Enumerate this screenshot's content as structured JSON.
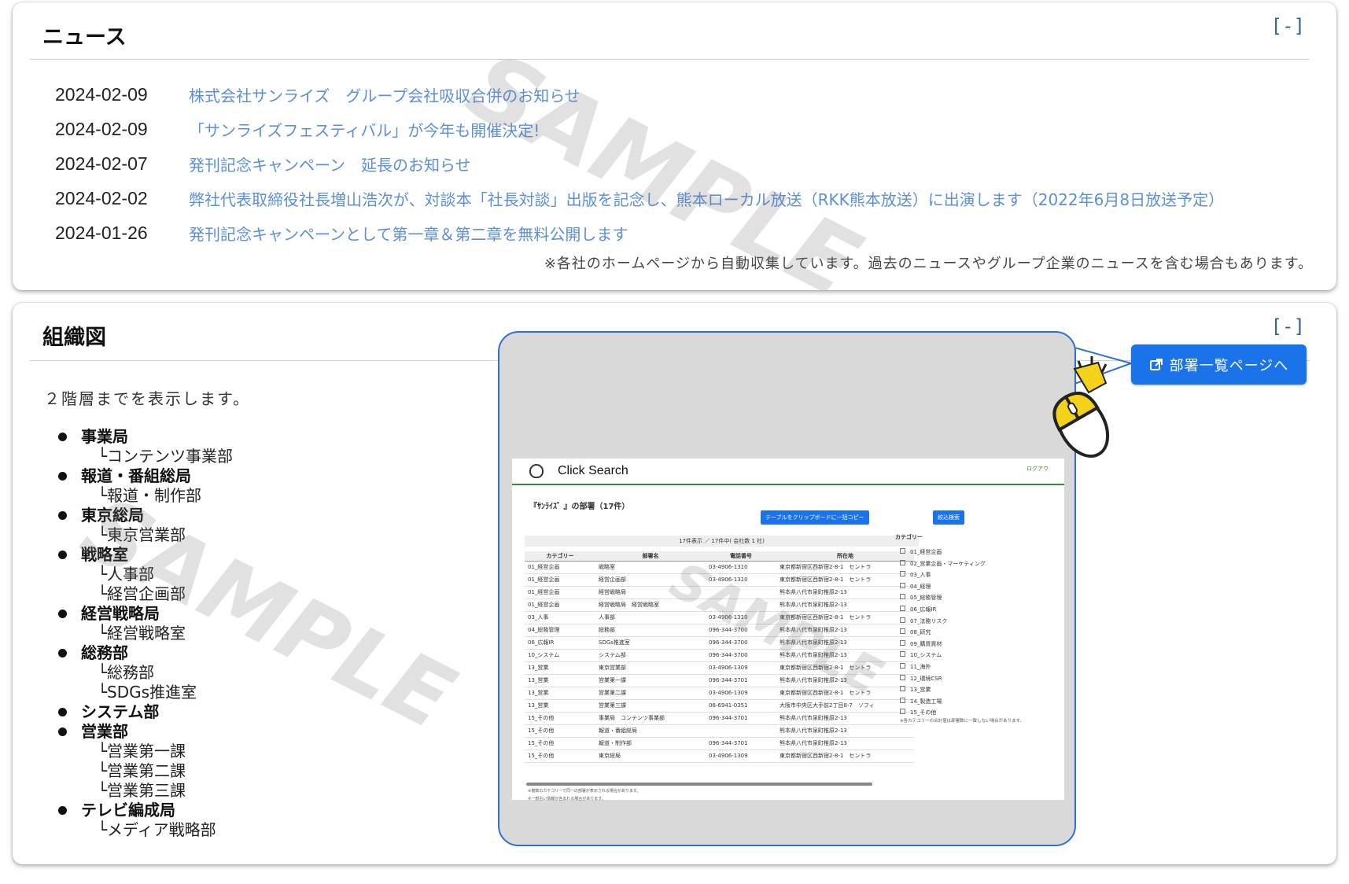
{
  "watermark": "SAMPLE",
  "news": {
    "title": "ニュース",
    "collapse_label": "[-]",
    "items": [
      {
        "date": "2024-02-09",
        "title": "株式会社サンライズ　グループ会社吸収合併のお知らせ"
      },
      {
        "date": "2024-02-09",
        "title": "「サンライズフェスティバル」が今年も開催決定!"
      },
      {
        "date": "2024-02-07",
        "title": "発刊記念キャンペーン　延長のお知らせ"
      },
      {
        "date": "2024-02-02",
        "title": "弊社代表取締役社長増山浩次が、対談本「社長対談」出版を記念し、熊本ローカル放送（RKK熊本放送）に出演します（2022年6月8日放送予定）"
      },
      {
        "date": "2024-01-26",
        "title": "発刊記念キャンペーンとして第一章＆第二章を無料公開します"
      }
    ],
    "note": "※各社のホームページから自動収集しています。過去のニュースやグループ企業のニュースを含む場合もあります。"
  },
  "org": {
    "title": "組織図",
    "collapse_label": "[-]",
    "description": "２階層までを表示します。",
    "departments": [
      {
        "name": "事業局",
        "subs": [
          "└コンテンツ事業部"
        ]
      },
      {
        "name": "報道・番組総局",
        "subs": [
          "└報道・制作部"
        ]
      },
      {
        "name": "東京総局",
        "subs": [
          "└東京営業部"
        ]
      },
      {
        "name": "戦略室",
        "subs": [
          "└人事部",
          "└経営企画部"
        ]
      },
      {
        "name": "経営戦略局",
        "subs": [
          "└経営戦略室"
        ]
      },
      {
        "name": "総務部",
        "subs": [
          "└総務部",
          "└SDGs推進室"
        ]
      },
      {
        "name": "システム部",
        "subs": []
      },
      {
        "name": "営業部",
        "subs": [
          "└営業第一課",
          "└営業第二課",
          "└営業第三課"
        ]
      },
      {
        "name": "テレビ編成局",
        "subs": [
          "└メディア戦略部"
        ]
      }
    ],
    "dept_page_button": "部署一覧ページへ",
    "preview": {
      "app_title": "Click Search",
      "logout": "ログアウ",
      "subtitle": "『ｻﾝﾗｲｽﾞ 』の部署（17件）",
      "copy_button": "テーブルをクリップボードに一括コピー",
      "filter_button": "絞込検索",
      "count_text": "17件表示 ／ 17件中( 会社数 1 社)",
      "columns": [
        "カテゴリー",
        "部署名",
        "電話番号",
        "所在地"
      ],
      "rows": [
        [
          "01_経営企画",
          "戦略室",
          "03-4906-1310",
          "東京都新宿区西新宿2-8-1　セントラ"
        ],
        [
          "01_経営企画",
          "経営企画部",
          "03-4906-1310",
          "東京都新宿区西新宿2-8-1　セントラ"
        ],
        [
          "01_経営企画",
          "経営戦略局",
          "",
          "熊本県八代市泉町椎原2-13"
        ],
        [
          "01_経営企画",
          "経営戦略局　経営戦略室",
          "",
          "熊本県八代市泉町椎原2-13"
        ],
        [
          "03_人事",
          "人事部",
          "03-4906-1310",
          "東京都新宿区西新宿2-8-1　セントラ"
        ],
        [
          "04_総務管理",
          "総務部",
          "096-344-3700",
          "熊本県八代市泉町椎原2-13"
        ],
        [
          "06_広報IR",
          "SDGs推進室",
          "096-344-3700",
          "熊本県八代市泉町椎原2-13"
        ],
        [
          "10_システム",
          "システム部",
          "096-344-3700",
          "熊本県八代市泉町椎原2-13"
        ],
        [
          "13_営業",
          "東京営業部",
          "03-4906-1309",
          "東京都新宿区西新宿2-8-1　セントラ"
        ],
        [
          "13_営業",
          "営業第一課",
          "096-344-3701",
          "熊本県八代市泉町椎原2-13"
        ],
        [
          "13_営業",
          "営業第二課",
          "03-4906-1309",
          "東京都新宿区西新宿2-8-1　セントラ"
        ],
        [
          "13_営業",
          "営業第三課",
          "06-6941-0351",
          "大阪市中央区大手前2丁目8-7　ソフィ"
        ],
        [
          "15_その他",
          "事業局　コンテンツ事業部",
          "096-344-3701",
          "熊本県八代市泉町椎原2-13"
        ],
        [
          "15_その他",
          "報道・番組総局",
          "",
          "熊本県八代市泉町椎原2-13"
        ],
        [
          "15_その他",
          "報道・制作部",
          "096-344-3701",
          "熊本県八代市泉町椎原2-13"
        ],
        [
          "15_その他",
          "東京総局",
          "03-4906-1309",
          "東京都新宿区西新宿2-8-1　セントラ"
        ]
      ],
      "notes": [
        "※複数のカテゴリーで同一の部署が表示される場合があります。",
        "※一部古い情報が含まれる場合があります。"
      ],
      "category_title": "カテゴリー",
      "categories": [
        "01_経営企画",
        "02_営業企画・マーケティング",
        "03_人事",
        "04_経理",
        "05_総務管理",
        "06_広報IR",
        "07_法務リスク",
        "08_研究",
        "09_購買資材",
        "10_システム",
        "11_海外",
        "12_環境CSR",
        "13_営業",
        "14_製造工場",
        "15_その他"
      ],
      "category_note": "※各カテゴリーの合計値は部署数に一致しない場合があります。"
    }
  }
}
